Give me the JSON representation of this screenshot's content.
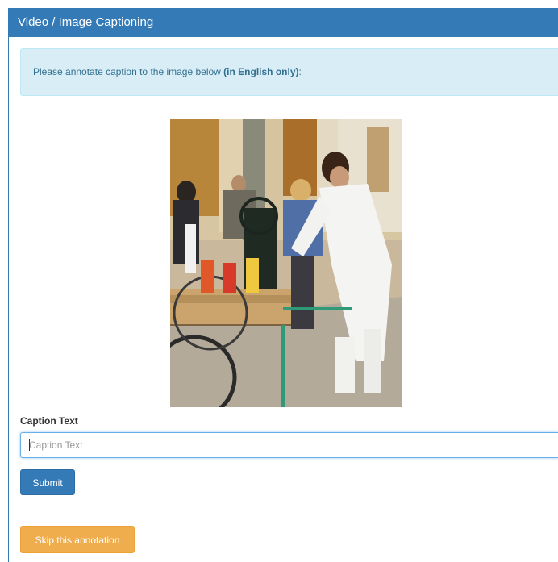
{
  "header": {
    "title": "Video / Image Captioning"
  },
  "instructions": {
    "text": "Please annotate caption to the image below ",
    "emphasis": "(in English only)",
    "suffix": ":"
  },
  "form": {
    "caption_label": "Caption Text",
    "caption_placeholder": "Caption Text",
    "caption_value": "",
    "submit_label": "Submit",
    "skip_label": "Skip this annotation"
  },
  "colors": {
    "primary": "#337ab7",
    "info_bg": "#d9edf7",
    "warning": "#f0ad4e"
  }
}
